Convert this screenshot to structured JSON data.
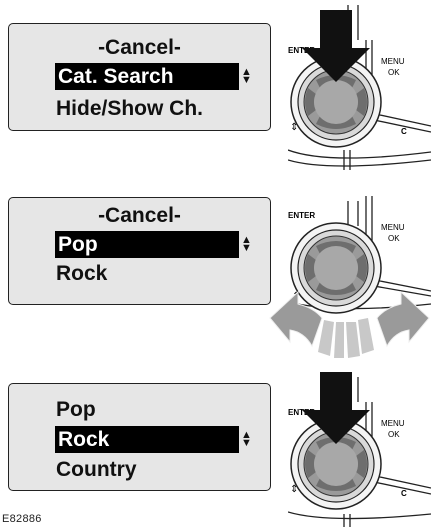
{
  "panels": [
    {
      "menu": [
        {
          "text": "-Cancel-",
          "selected": false
        },
        {
          "text": "Cat. Search",
          "selected": true
        },
        {
          "text": "Hide/Show Ch.",
          "selected": false
        }
      ],
      "control": {
        "enter_label": "ENTER",
        "menu_label": "MENU",
        "ok_label": "OK",
        "c_label": "C",
        "action": "press"
      }
    },
    {
      "menu": [
        {
          "text": "-Cancel-",
          "selected": false
        },
        {
          "text": "Pop",
          "selected": true
        },
        {
          "text": "Rock",
          "selected": false
        }
      ],
      "control": {
        "enter_label": "ENTER",
        "menu_label": "MENU",
        "ok_label": "OK",
        "action": "rotate"
      }
    },
    {
      "menu": [
        {
          "text": "Pop",
          "selected": false
        },
        {
          "text": "Rock",
          "selected": true
        },
        {
          "text": "Country",
          "selected": false
        }
      ],
      "control": {
        "enter_label": "ENTER",
        "menu_label": "MENU",
        "ok_label": "OK",
        "c_label": "C",
        "action": "press"
      }
    }
  ],
  "figure_code": "E82886"
}
